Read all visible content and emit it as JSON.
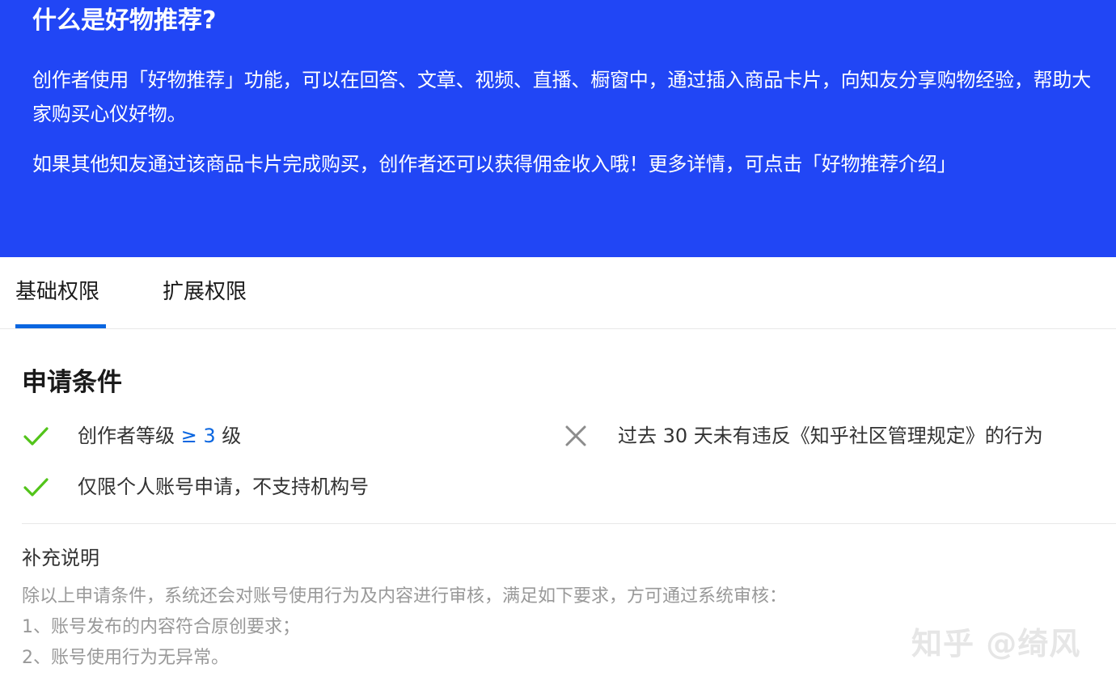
{
  "hero": {
    "title": "什么是好物推荐?",
    "paragraph1": "创作者使用「好物推荐」功能，可以在回答、文章、视频、直播、橱窗中，通过插入商品卡片，向知友分享购物经验，帮助大家购买心仪好物。",
    "paragraph2_prefix": "如果其他知友通过该商品卡片完成购买，创作者还可以获得佣金收入哦！更多详情，可点击",
    "paragraph2_link": "「好物推荐介绍」",
    "background_color": "#2146f5"
  },
  "tabs": [
    {
      "label": "基础权限",
      "active": true
    },
    {
      "label": "扩展权限",
      "active": false
    }
  ],
  "conditions": {
    "title": "申请条件",
    "items": [
      {
        "icon": "check-icon",
        "status": "met",
        "text_prefix": "创作者等级 ",
        "highlight": "≥ 3",
        "text_suffix": " 级"
      },
      {
        "icon": "cross-icon",
        "status": "not-met",
        "text": "过去 30 天未有违反《知乎社区管理规定》的行为"
      },
      {
        "icon": "check-icon",
        "status": "met",
        "text": "仅限个人账号申请，不支持机构号"
      }
    ],
    "met_color": "#52c41a",
    "not_met_color": "#8c8c8c",
    "highlight_color": "#0a66e0"
  },
  "supplement": {
    "title": "补充说明",
    "lines": [
      "除以上申请条件，系统还会对账号使用行为及内容进行审核，满足如下要求，方可通过系统审核：",
      "1、账号发布的内容符合原创要求；",
      "2、账号使用行为无异常。"
    ]
  },
  "watermark": "知乎 @绮风"
}
